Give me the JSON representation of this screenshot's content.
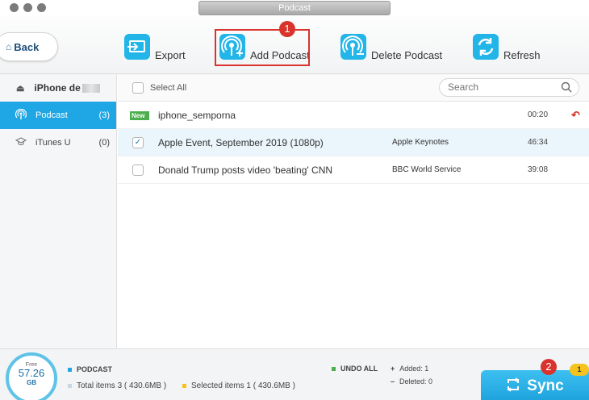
{
  "window": {
    "title": "Podcast"
  },
  "toolbar": {
    "back_label": "Back",
    "export_label": "Export",
    "add_label": "Add Podcast",
    "delete_label": "Delete Podcast",
    "refresh_label": "Refresh",
    "step1": "1"
  },
  "sidebar": {
    "device_name": "iPhone de",
    "items": [
      {
        "label": "Podcast",
        "count": "(3)",
        "icon": "podcast-icon"
      },
      {
        "label": "iTunes U",
        "count": "(0)",
        "icon": "itunes-u-icon"
      }
    ]
  },
  "list": {
    "select_all": "Select All",
    "search_placeholder": "Search",
    "rows": [
      {
        "tag": "New",
        "title": "iphone_semporna",
        "source": "",
        "time": "00:20",
        "checked": false
      },
      {
        "title": "Apple Event, September 2019 (1080p)",
        "source": "Apple Keynotes",
        "time": "46:34",
        "checked": true
      },
      {
        "title": "Donald Trump posts video 'beating' CNN",
        "source": "BBC World Service",
        "time": "39:08",
        "checked": false
      }
    ]
  },
  "footer": {
    "free_label": "Free",
    "free_value": "57.26",
    "free_unit": "GB",
    "section_label": "PODCAST",
    "total_items": "Total items 3 ( 430.6MB )",
    "selected_items": "Selected items 1 ( 430.6MB )",
    "undo_all": "UNDO ALL",
    "added": "Added: 1",
    "deleted": "Deleted: 0",
    "sync_label": "Sync",
    "step2": "2",
    "pending_badge": "1"
  },
  "colors": {
    "accent": "#1ea7e4",
    "highlight": "#d9332d",
    "new_tag": "#4cae4c",
    "badge": "#f6c21c"
  }
}
